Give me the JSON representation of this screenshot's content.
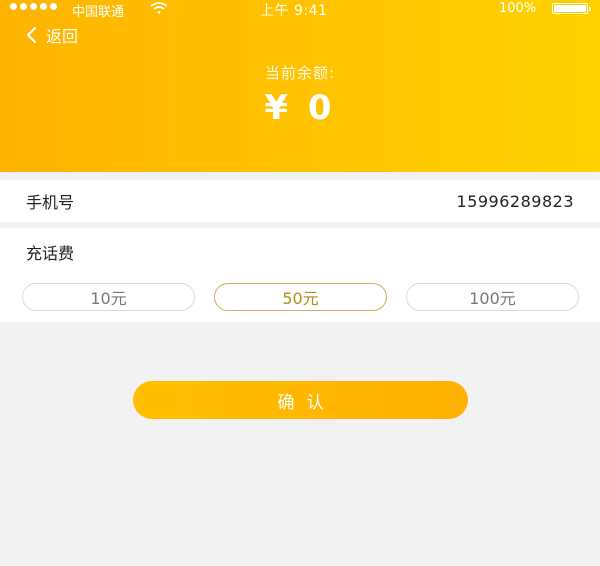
{
  "status_bar": {
    "carrier": "中国联通",
    "time": "上午 9:41",
    "battery": "100%"
  },
  "header": {
    "back_label": "返回",
    "balance_label": "当前余额:",
    "balance_value": "¥ 0"
  },
  "phone": {
    "label": "手机号",
    "value": "15996289823"
  },
  "recharge": {
    "title": "充话费",
    "options": [
      "10元",
      "50元",
      "100元"
    ],
    "selected": "50元"
  },
  "confirm_label": "确认",
  "colors": {
    "header_start": "#ffb300",
    "header_end": "#ffd200",
    "button": "#ffb800",
    "selected_border": "#c9b25a",
    "selected_text": "#b08d1a",
    "background": "#f2f2f2"
  },
  "icons": {
    "back": "chevron-left-icon",
    "wifi": "wifi-icon",
    "battery": "battery-icon",
    "signal": "signal-dots-icon"
  }
}
